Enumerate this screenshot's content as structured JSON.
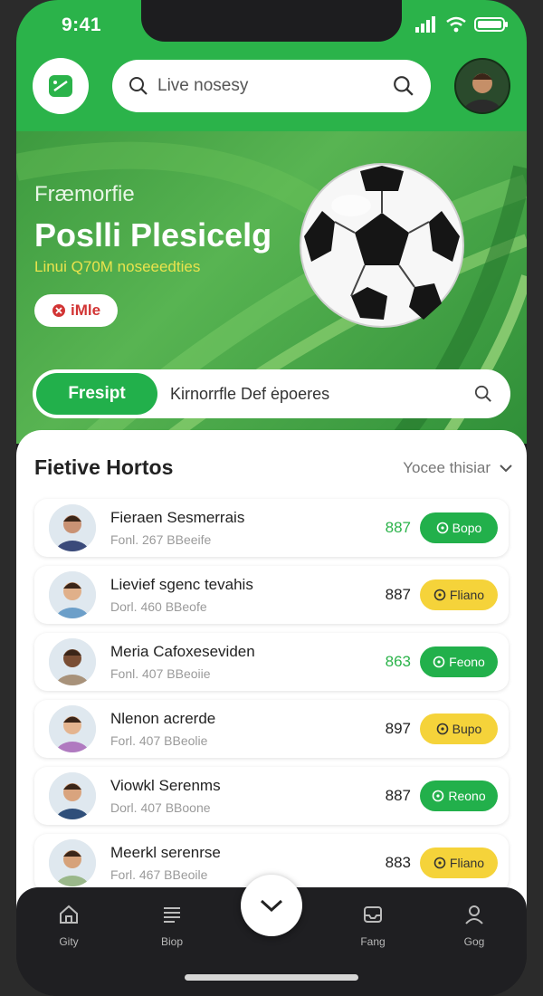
{
  "status": {
    "time": "9:41"
  },
  "search": {
    "placeholder": "Live nosesy"
  },
  "hero": {
    "subtitle": "Fræmorfie",
    "title": "Poslli Plesicelg",
    "line": "Linui Q70M noseeedties",
    "badge": "iMle",
    "button": "Fresipt",
    "bar_text": "Kirnorrfle Def ėpoeres"
  },
  "list": {
    "title": "Fietive Hortos",
    "filter": "Yocee thisiar",
    "rows": [
      {
        "name": "Fieraen Sesmerrais",
        "meta": "Fonl. 267 BBeeife",
        "score": "887",
        "score_color": "#2bb34a",
        "pill": "Bopo",
        "pill_style": "green"
      },
      {
        "name": "Lievief sgenc tevahis",
        "meta": "Dorl. 460 BBeofe",
        "score": "887",
        "score_color": "#222222",
        "pill": "Fliano",
        "pill_style": "yellow"
      },
      {
        "name": "Meria Cafoxeseviden",
        "meta": "Fonl. 407 BBeoiie",
        "score": "863",
        "score_color": "#2bb34a",
        "pill": "Feono",
        "pill_style": "green"
      },
      {
        "name": "Nlenon acrerde",
        "meta": "Forl. 407 BBeolie",
        "score": "897",
        "score_color": "#222222",
        "pill": "Bupo",
        "pill_style": "yellow"
      },
      {
        "name": "Viowkl Serenms",
        "meta": "Dorl. 407 BBoone",
        "score": "887",
        "score_color": "#222222",
        "pill": "Reono",
        "pill_style": "green"
      },
      {
        "name": "Meerkl serenrse",
        "meta": "Forl. 467 BBeoile",
        "score": "883",
        "score_color": "#222222",
        "pill": "Fliano",
        "pill_style": "yellow"
      }
    ]
  },
  "nav": [
    {
      "label": "Gity",
      "icon": "home-icon"
    },
    {
      "label": "Biop",
      "icon": "menu-icon"
    },
    {
      "label": "Fang",
      "icon": "inbox-icon"
    },
    {
      "label": "Gog",
      "icon": "profile-icon"
    }
  ],
  "colors": {
    "brand": "#2bb34a",
    "accent_yellow": "#f5d33a",
    "dark": "#1d1d1f"
  }
}
